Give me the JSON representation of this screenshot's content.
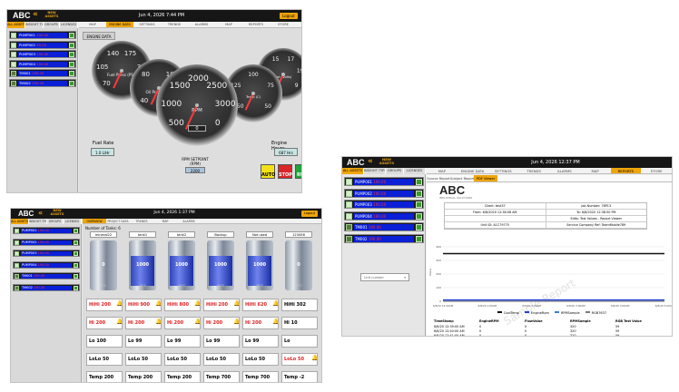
{
  "common": {
    "logo": "ABC",
    "new_assets": "NEW ASSETS",
    "login": "Logout",
    "sub_tabs": [
      "ALL ASSETS",
      "INSIGHT TYPE",
      "GROUPS",
      "LICENSES"
    ]
  },
  "win1": {
    "datetime": "Jun 4, 2026 7:44 PM",
    "nav_tabs": [
      "MAP",
      "ENGINE DATA",
      "SETTINGS",
      "TRENDS",
      "ALARMS",
      "MAP",
      "REPORTS",
      "STORE"
    ],
    "items": [
      {
        "name": "PUMP001",
        "val": "190.00"
      },
      {
        "name": "PUMP002",
        "val": "30.00"
      },
      {
        "name": "PUMP003",
        "val": "190.00"
      },
      {
        "name": "PUMP004",
        "val": "190.00"
      },
      {
        "name": "TM001",
        "val": "190.00"
      },
      {
        "name": "TM002",
        "val": "190.00"
      }
    ],
    "engine_data_button": "ENGINE DATA",
    "fuel_rate": {
      "label": "Fuel Rate",
      "value": "1.0",
      "unit": "L/Hr"
    },
    "engine_hours": {
      "label": "Engine Hours",
      "value": "687",
      "unit": "Hrs"
    },
    "rpm_setpoint": {
      "label": "RPM SETPOINT (RPM)",
      "value": "2200"
    },
    "controls": {
      "auto": "AUTO",
      "stop": "STOP",
      "run": "RUN"
    },
    "gauges": {
      "fuel_pressure": {
        "ticks": [
          "70",
          "105",
          "140",
          "175",
          "35",
          "0"
        ],
        "unit": "Fuel Press (PSI)",
        "value": "0"
      },
      "oil_pressure": {
        "ticks": [
          "40",
          "80",
          "100",
          "0"
        ],
        "unit": "Oil Press (PSI)",
        "value": "0"
      },
      "rpm": {
        "ticks": [
          "500",
          "1000",
          "1500",
          "2000",
          "2500",
          "3000",
          "0"
        ],
        "unit": "RPM",
        "value": "0"
      },
      "coolant_temp": {
        "ticks": [
          "150",
          "125",
          "100",
          "75",
          "50"
        ],
        "unit": "Temp (C)",
        "value": "0"
      },
      "battery": {
        "ticks": [
          "11",
          "13",
          "15",
          "17",
          "19",
          "9"
        ],
        "unit": "Bat (Volts)",
        "value": "0"
      }
    }
  },
  "win2": {
    "datetime": "Jun 4, 2026 1:37 PM",
    "nav_tabs": [
      "OVERVIEW",
      "PROJECT DATA",
      "TRENDS",
      "MAP",
      "ALARMS"
    ],
    "tank_header": "Number of Tanks: 6",
    "items": [
      {
        "name": "PUMP001",
        "val": "190.00"
      },
      {
        "name": "PUMP002",
        "val": "190.00"
      },
      {
        "name": "PUMP003",
        "val": "190.00"
      },
      {
        "name": "PUMP004",
        "val": "190.00"
      },
      {
        "name": "TM001",
        "val": "190.00"
      },
      {
        "name": "TM002",
        "val": "190.00"
      }
    ],
    "tanks": [
      {
        "name": "mineral22",
        "value": "0",
        "temp": "0°C",
        "level": 0,
        "hihi": "HiHi",
        "hihi_v": "200",
        "hi": "Hi",
        "hi_v": "200",
        "lo": "Lo",
        "lo_v": "100",
        "lolo": "LoLo",
        "lolo_v": "50",
        "temp_l": "Temp",
        "temp_v": "200",
        "hihi_alarm": true,
        "hi_alarm": true,
        "lo_alarm": false,
        "lolo_alarm": false
      },
      {
        "name": "tank1",
        "value": "1000",
        "temp": "20°C",
        "level": 0.75,
        "hihi": "HiHi",
        "hihi_v": "900",
        "hi": "Hi",
        "hi_v": "200",
        "lo": "Lo",
        "lo_v": "99",
        "lolo": "LoLo",
        "lolo_v": "50",
        "temp_l": "Temp",
        "temp_v": "200",
        "hihi_alarm": true,
        "hi_alarm": true,
        "lo_alarm": false,
        "lolo_alarm": false
      },
      {
        "name": "tank2",
        "value": "1000",
        "temp": "20°C",
        "level": 0.75,
        "hihi": "HiHi",
        "hihi_v": "800",
        "hi": "Hi",
        "hi_v": "200",
        "lo": "Lo",
        "lo_v": "99",
        "lolo": "LoLo",
        "lolo_v": "50",
        "temp_l": "Temp",
        "temp_v": "200",
        "hihi_alarm": true,
        "hi_alarm": true,
        "lo_alarm": false,
        "lolo_alarm": false
      },
      {
        "name": "Backup",
        "value": "1000",
        "temp": "30°C",
        "level": 0.75,
        "hihi": "HiHi",
        "hihi_v": "200",
        "hi": "Hi",
        "hi_v": "200",
        "lo": "Lo",
        "lo_v": "99",
        "lolo": "LoLo",
        "lolo_v": "50",
        "temp_l": "Temp",
        "temp_v": "700",
        "hihi_alarm": true,
        "hi_alarm": true,
        "lo_alarm": false,
        "lolo_alarm": false
      },
      {
        "name": "Not used",
        "value": "1000",
        "temp": "28°C",
        "level": 0.75,
        "hihi": "HiHi",
        "hihi_v": "620",
        "hi": "Hi",
        "hi_v": "200",
        "lo": "Lo",
        "lo_v": "99",
        "lolo": "LoLo",
        "lolo_v": "50",
        "temp_l": "Temp",
        "temp_v": "700",
        "hihi_alarm": true,
        "hi_alarm": true,
        "lo_alarm": false,
        "lolo_alarm": false
      },
      {
        "name": "123456",
        "value": "0",
        "temp": "-2°C",
        "level": 0,
        "hihi": "HiHi",
        "hihi_v": "302",
        "hi": "Hi",
        "hi_v": "10",
        "lo": "Lo",
        "lo_v": "",
        "lolo": "LoLo",
        "lolo_v": "50",
        "temp_l": "Temp",
        "temp_v": "-2",
        "hihi_alarm": false,
        "hi_alarm": false,
        "lo_alarm": false,
        "lolo_alarm": true
      }
    ]
  },
  "win3": {
    "datetime": "Jun 4, 2026 12:37 PM",
    "nav_tabs": [
      "MAP",
      "ENGINE DATA",
      "SETTINGS",
      "TRENDS",
      "ALARMS",
      "MAP",
      "REPORTS",
      "STORE"
    ],
    "report_tabs": [
      "Source Report",
      "Subject Report",
      "PDF Viewer"
    ],
    "items": [
      {
        "name": "PUMP001",
        "val": "190.00"
      },
      {
        "name": "PUMP002",
        "val": "190.00"
      },
      {
        "name": "PUMP003",
        "val": "190.00"
      },
      {
        "name": "PUMP004",
        "val": "190.00"
      },
      {
        "name": "TM001",
        "val": "190.00"
      },
      {
        "name": "TM002",
        "val": "190.00"
      }
    ],
    "unit_select": "Unit number",
    "report_sub": "INDUSTRIAL SOLUTIONS",
    "report_rows": [
      [
        "Client: test37",
        "Job Number: 78P13"
      ],
      [
        "From: 6/8/2020 12:38:08 AM",
        "To: 6/8/2020 12:38:50 PM"
      ],
      [
        "",
        "Edits: Test Values - Report Viewer"
      ],
      [
        "Unit ID: A1C79775",
        "Service Company Ref: TeamMobile789"
      ]
    ],
    "watermark": "Sample Report",
    "chart_legend": [
      "CoolTemp",
      "EngineRpm",
      "RPMSample",
      "RGB7637"
    ],
    "table_head": [
      "TimeStamp",
      "EngineRPM",
      "FlowValue",
      "RPMSample",
      "RGB Test Value"
    ],
    "table_rows": [
      [
        "6/8/20 12:39:00 AM",
        "0",
        "0",
        "320",
        "59"
      ],
      [
        "6/8/20 12:40:00 AM",
        "0",
        "0",
        "320",
        "59"
      ],
      [
        "6/8/20 12:41:00 AM",
        "0",
        "0",
        "320",
        "59"
      ],
      [
        "6/8/20 12:42:00 AM",
        "0",
        "0",
        "320",
        "59"
      ]
    ]
  },
  "chart_data": {
    "type": "line",
    "x": [
      "6/8/20 12:00AM",
      "6/8/20 1:00AM",
      "6/8/20 2:00AM",
      "6/8/20 3:00AM",
      "6/8/20 4:00AM",
      "6/8/20 5:00AM"
    ],
    "ylabel": "Value",
    "ylim": [
      0,
      400
    ],
    "yticks": [
      "400",
      "300",
      "200",
      "100",
      "0"
    ],
    "series": [
      {
        "name": "CoolTemp",
        "color": "#111111",
        "values": [
          350,
          350,
          350,
          350,
          350,
          350
        ]
      },
      {
        "name": "EngineRpm",
        "color": "#1f3bd6",
        "values": [
          10,
          10,
          10,
          10,
          10,
          10
        ]
      },
      {
        "name": "RPMSample",
        "color": "#3b7dd8",
        "values": [
          2,
          2,
          2,
          2,
          2,
          2
        ]
      },
      {
        "name": "RGB7637",
        "color": "#7c7c7c",
        "values": [
          0,
          0,
          0,
          0,
          0,
          0
        ]
      }
    ]
  }
}
